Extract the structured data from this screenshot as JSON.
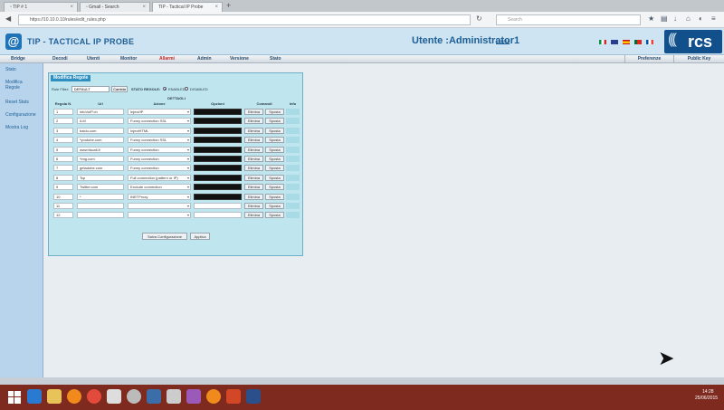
{
  "browser": {
    "tabs": [
      {
        "label": "▫ TIP # 1"
      },
      {
        "label": "▫ Gmail - Search"
      },
      {
        "label": "TIP - Tactical IP Probe"
      }
    ],
    "url": "https://10.10.0.10/rules/edit_rules.php",
    "search_placeholder": "Search"
  },
  "header": {
    "logo": "@",
    "title": "TIP - TACTICAL IP PROBE",
    "user": "Utente :Administrator1",
    "logout": "Logout",
    "brand": "rcs"
  },
  "menu": {
    "items": [
      "Bridge",
      "Decodi",
      "Utenti",
      "Monitor",
      "Allarmi",
      "Admin",
      "Versione",
      "Stato"
    ],
    "active": "Allarmi",
    "right": [
      "Preferenze",
      "Public Key"
    ]
  },
  "sidebar": {
    "items": [
      "Stato",
      "Modifica Regole",
      "Reset Stats",
      "Configurazione",
      "Mostra Log"
    ]
  },
  "panel": {
    "title": "Modifica Regole",
    "filter_label": "Rule Filter:",
    "filter_value": "DEFAULT",
    "cambia": "Cambia",
    "stato_label": "STATO REGOLE:",
    "enabled": "ENABLED",
    "disabled": "DISABLED",
    "dettagli": "DETTAGLI",
    "headers": {
      "num": "Regola N.",
      "url": "Url",
      "action": "Azione",
      "options": "Opzioni",
      "commands": "Comandi",
      "info": "Info"
    },
    "delete_label": "Elimina",
    "move_label": "Sposta",
    "save": "Salva Configurazione",
    "apply": "Applica",
    "rows": [
      {
        "num": "1",
        "url": "infoVoIP.ch",
        "action": "Inject/IP"
      },
      {
        "num": "2",
        "url": "ILM",
        "action": "Funny connection SSL"
      },
      {
        "num": "3",
        "url": "baidu.com",
        "action": "InjectHTML"
      },
      {
        "num": "4",
        "url": "*youtube.com",
        "action": "Funny connection SSL"
      },
      {
        "num": "5",
        "url": "www.tiscali.it",
        "action": "Funny connection"
      },
      {
        "num": "6",
        "url": "*img.com",
        "action": "Funny connection"
      },
      {
        "num": "7",
        "url": "getadobe.com",
        "action": "Funny connection"
      },
      {
        "num": "8",
        "url": "Tcp",
        "action": "Full connection (pattern or IP)"
      },
      {
        "num": "9",
        "url": "Twitter.com",
        "action": "Exclude connection"
      },
      {
        "num": "10",
        "url": "*",
        "action": "INETProxy"
      },
      {
        "num": "11",
        "url": "",
        "action": ""
      },
      {
        "num": "12",
        "url": "",
        "action": ""
      }
    ]
  },
  "taskbar": {
    "time": "14:28",
    "date": "25/06/2015"
  }
}
